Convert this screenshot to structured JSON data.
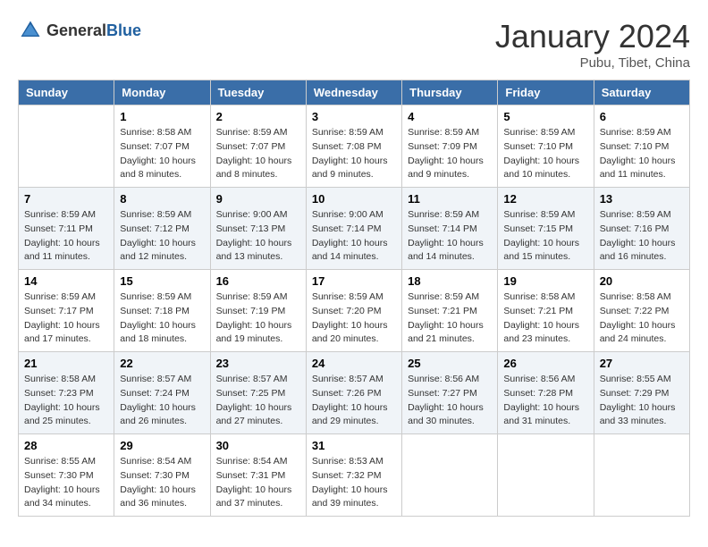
{
  "header": {
    "logo_general": "General",
    "logo_blue": "Blue",
    "month": "January 2024",
    "location": "Pubu, Tibet, China"
  },
  "weekdays": [
    "Sunday",
    "Monday",
    "Tuesday",
    "Wednesday",
    "Thursday",
    "Friday",
    "Saturday"
  ],
  "weeks": [
    [
      {
        "day": "",
        "info": ""
      },
      {
        "day": "1",
        "info": "Sunrise: 8:58 AM\nSunset: 7:07 PM\nDaylight: 10 hours\nand 8 minutes."
      },
      {
        "day": "2",
        "info": "Sunrise: 8:59 AM\nSunset: 7:07 PM\nDaylight: 10 hours\nand 8 minutes."
      },
      {
        "day": "3",
        "info": "Sunrise: 8:59 AM\nSunset: 7:08 PM\nDaylight: 10 hours\nand 9 minutes."
      },
      {
        "day": "4",
        "info": "Sunrise: 8:59 AM\nSunset: 7:09 PM\nDaylight: 10 hours\nand 9 minutes."
      },
      {
        "day": "5",
        "info": "Sunrise: 8:59 AM\nSunset: 7:10 PM\nDaylight: 10 hours\nand 10 minutes."
      },
      {
        "day": "6",
        "info": "Sunrise: 8:59 AM\nSunset: 7:10 PM\nDaylight: 10 hours\nand 11 minutes."
      }
    ],
    [
      {
        "day": "7",
        "info": "Sunrise: 8:59 AM\nSunset: 7:11 PM\nDaylight: 10 hours\nand 11 minutes."
      },
      {
        "day": "8",
        "info": "Sunrise: 8:59 AM\nSunset: 7:12 PM\nDaylight: 10 hours\nand 12 minutes."
      },
      {
        "day": "9",
        "info": "Sunrise: 9:00 AM\nSunset: 7:13 PM\nDaylight: 10 hours\nand 13 minutes."
      },
      {
        "day": "10",
        "info": "Sunrise: 9:00 AM\nSunset: 7:14 PM\nDaylight: 10 hours\nand 14 minutes."
      },
      {
        "day": "11",
        "info": "Sunrise: 8:59 AM\nSunset: 7:14 PM\nDaylight: 10 hours\nand 14 minutes."
      },
      {
        "day": "12",
        "info": "Sunrise: 8:59 AM\nSunset: 7:15 PM\nDaylight: 10 hours\nand 15 minutes."
      },
      {
        "day": "13",
        "info": "Sunrise: 8:59 AM\nSunset: 7:16 PM\nDaylight: 10 hours\nand 16 minutes."
      }
    ],
    [
      {
        "day": "14",
        "info": "Sunrise: 8:59 AM\nSunset: 7:17 PM\nDaylight: 10 hours\nand 17 minutes."
      },
      {
        "day": "15",
        "info": "Sunrise: 8:59 AM\nSunset: 7:18 PM\nDaylight: 10 hours\nand 18 minutes."
      },
      {
        "day": "16",
        "info": "Sunrise: 8:59 AM\nSunset: 7:19 PM\nDaylight: 10 hours\nand 19 minutes."
      },
      {
        "day": "17",
        "info": "Sunrise: 8:59 AM\nSunset: 7:20 PM\nDaylight: 10 hours\nand 20 minutes."
      },
      {
        "day": "18",
        "info": "Sunrise: 8:59 AM\nSunset: 7:21 PM\nDaylight: 10 hours\nand 21 minutes."
      },
      {
        "day": "19",
        "info": "Sunrise: 8:58 AM\nSunset: 7:21 PM\nDaylight: 10 hours\nand 23 minutes."
      },
      {
        "day": "20",
        "info": "Sunrise: 8:58 AM\nSunset: 7:22 PM\nDaylight: 10 hours\nand 24 minutes."
      }
    ],
    [
      {
        "day": "21",
        "info": "Sunrise: 8:58 AM\nSunset: 7:23 PM\nDaylight: 10 hours\nand 25 minutes."
      },
      {
        "day": "22",
        "info": "Sunrise: 8:57 AM\nSunset: 7:24 PM\nDaylight: 10 hours\nand 26 minutes."
      },
      {
        "day": "23",
        "info": "Sunrise: 8:57 AM\nSunset: 7:25 PM\nDaylight: 10 hours\nand 27 minutes."
      },
      {
        "day": "24",
        "info": "Sunrise: 8:57 AM\nSunset: 7:26 PM\nDaylight: 10 hours\nand 29 minutes."
      },
      {
        "day": "25",
        "info": "Sunrise: 8:56 AM\nSunset: 7:27 PM\nDaylight: 10 hours\nand 30 minutes."
      },
      {
        "day": "26",
        "info": "Sunrise: 8:56 AM\nSunset: 7:28 PM\nDaylight: 10 hours\nand 31 minutes."
      },
      {
        "day": "27",
        "info": "Sunrise: 8:55 AM\nSunset: 7:29 PM\nDaylight: 10 hours\nand 33 minutes."
      }
    ],
    [
      {
        "day": "28",
        "info": "Sunrise: 8:55 AM\nSunset: 7:30 PM\nDaylight: 10 hours\nand 34 minutes."
      },
      {
        "day": "29",
        "info": "Sunrise: 8:54 AM\nSunset: 7:30 PM\nDaylight: 10 hours\nand 36 minutes."
      },
      {
        "day": "30",
        "info": "Sunrise: 8:54 AM\nSunset: 7:31 PM\nDaylight: 10 hours\nand 37 minutes."
      },
      {
        "day": "31",
        "info": "Sunrise: 8:53 AM\nSunset: 7:32 PM\nDaylight: 10 hours\nand 39 minutes."
      },
      {
        "day": "",
        "info": ""
      },
      {
        "day": "",
        "info": ""
      },
      {
        "day": "",
        "info": ""
      }
    ]
  ]
}
